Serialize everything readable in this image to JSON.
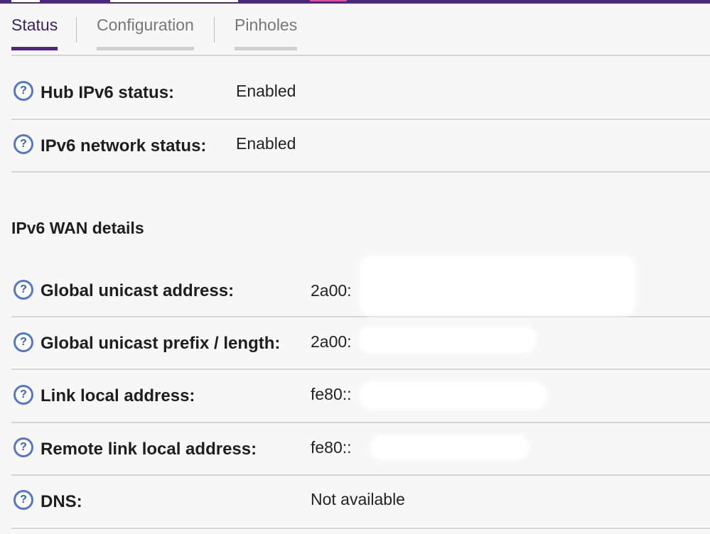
{
  "tabs": [
    {
      "label": "Status",
      "active": true
    },
    {
      "label": "Configuration",
      "active": false
    },
    {
      "label": "Pinholes",
      "active": false
    }
  ],
  "status_rows": [
    {
      "label": "Hub IPv6 status:",
      "value": "Enabled"
    },
    {
      "label": "IPv6 network status:",
      "value": "Enabled"
    }
  ],
  "wan_section": {
    "title": "IPv6 WAN details",
    "rows": [
      {
        "label": "Global unicast address:",
        "value": "2a00:"
      },
      {
        "label": "Global unicast prefix / length:",
        "value": "2a00:"
      },
      {
        "label": "Link local address:",
        "value": "fe80::"
      },
      {
        "label": "Remote link local address:",
        "value": "fe80::"
      },
      {
        "label": "DNS:",
        "value": "Not available"
      }
    ]
  },
  "icons": {
    "help": "help-icon",
    "help_glyph": "?"
  },
  "colors": {
    "accent": "#4a2a7c",
    "help_icon": "#5578c4",
    "pink": "#e0509c"
  }
}
